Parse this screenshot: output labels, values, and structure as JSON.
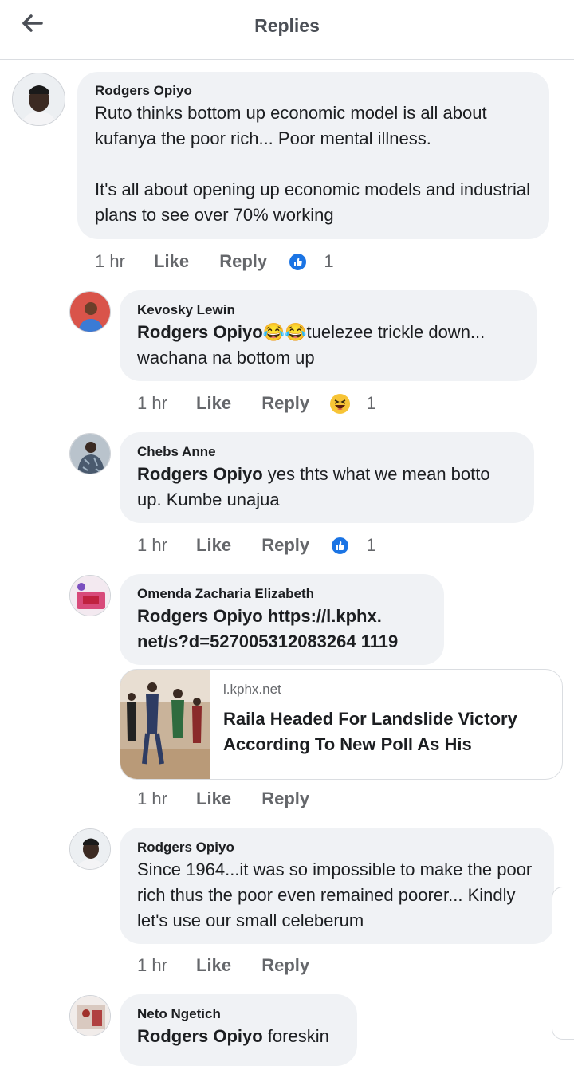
{
  "header": {
    "title": "Replies"
  },
  "actions": {
    "like": "Like",
    "reply": "Reply"
  },
  "comments": [
    {
      "author": "Rodgers Opiyo",
      "mention": "",
      "paragraphs": [
        "Ruto thinks bottom up economic model is all about kufanya the poor rich... Poor mental illness.",
        "It's all about opening up economic models and industrial plans to see over 70% working"
      ],
      "time": "1 hr",
      "reaction": "like",
      "reaction_count": "1"
    },
    {
      "author": "Kevosky Lewin",
      "mention": "Rodgers Opiyo",
      "emoji": "😂😂",
      "text": "tuelezee trickle down... wachana na bottom up",
      "time": "1 hr",
      "reaction": "haha",
      "reaction_count": "1"
    },
    {
      "author": "Chebs Anne",
      "mention": "Rodgers Opiyo",
      "text": " yes thts what we mean botto up. Kumbe unajua",
      "time": "1 hr",
      "reaction": "like",
      "reaction_count": "1"
    },
    {
      "author": "Omenda Zacharia Elizabeth",
      "mention": "Rodgers Opiyo",
      "link_line1": " https://l.kphx.",
      "link_line2": "net/s?d=527005312083264 1119",
      "time": "1 hr",
      "link_preview": {
        "domain": "l.kphx.net",
        "title": "Raila Headed For Landslide Victory According To New Poll As His"
      }
    },
    {
      "author": "Rodgers Opiyo",
      "text": "Since 1964...it was so impossible to make the poor rich thus the poor even remained poorer... Kindly let's use our small celeberum",
      "time": "1 hr"
    },
    {
      "author": "Neto Ngetich",
      "mention": "Rodgers Opiyo",
      "text": " foreskin"
    }
  ]
}
